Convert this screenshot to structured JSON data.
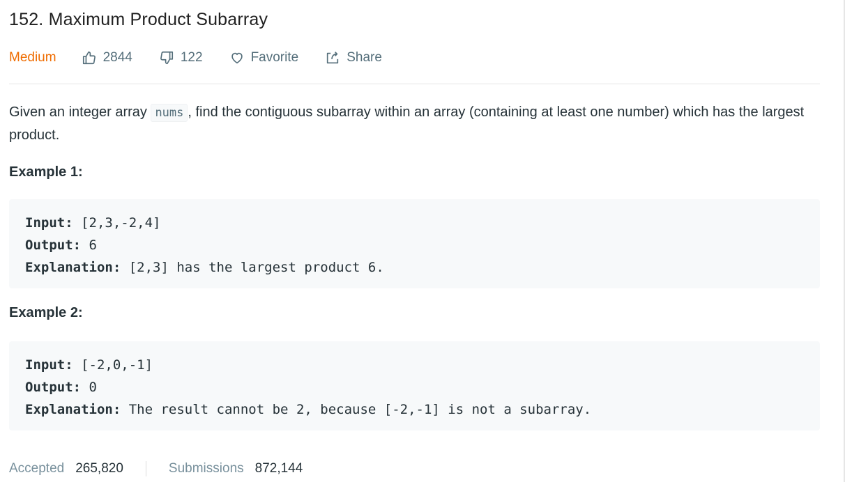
{
  "problem": {
    "title": "152. Maximum Product Subarray",
    "difficulty": "Medium",
    "likes": "2844",
    "dislikes": "122",
    "favorite_label": "Favorite",
    "share_label": "Share",
    "colors": {
      "difficulty": "#ef6c00",
      "muted": "#546e7a"
    }
  },
  "description": {
    "before": "Given an integer array ",
    "code": "nums",
    "after": ", find the contiguous subarray within an array (containing at least one number) which has the largest product."
  },
  "examples": [
    {
      "heading": "Example 1:",
      "input_label": "Input:",
      "input": " [2,3,-2,4]",
      "output_label": "Output:",
      "output": " 6",
      "explanation_label": "Explanation:",
      "explanation": " [2,3] has the largest product 6."
    },
    {
      "heading": "Example 2:",
      "input_label": "Input:",
      "input": " [-2,0,-1]",
      "output_label": "Output:",
      "output": " 0",
      "explanation_label": "Explanation:",
      "explanation": " The result cannot be 2, because [-2,-1] is not a subarray."
    }
  ],
  "stats": {
    "accepted_label": "Accepted",
    "accepted_value": "265,820",
    "submissions_label": "Submissions",
    "submissions_value": "872,144"
  }
}
